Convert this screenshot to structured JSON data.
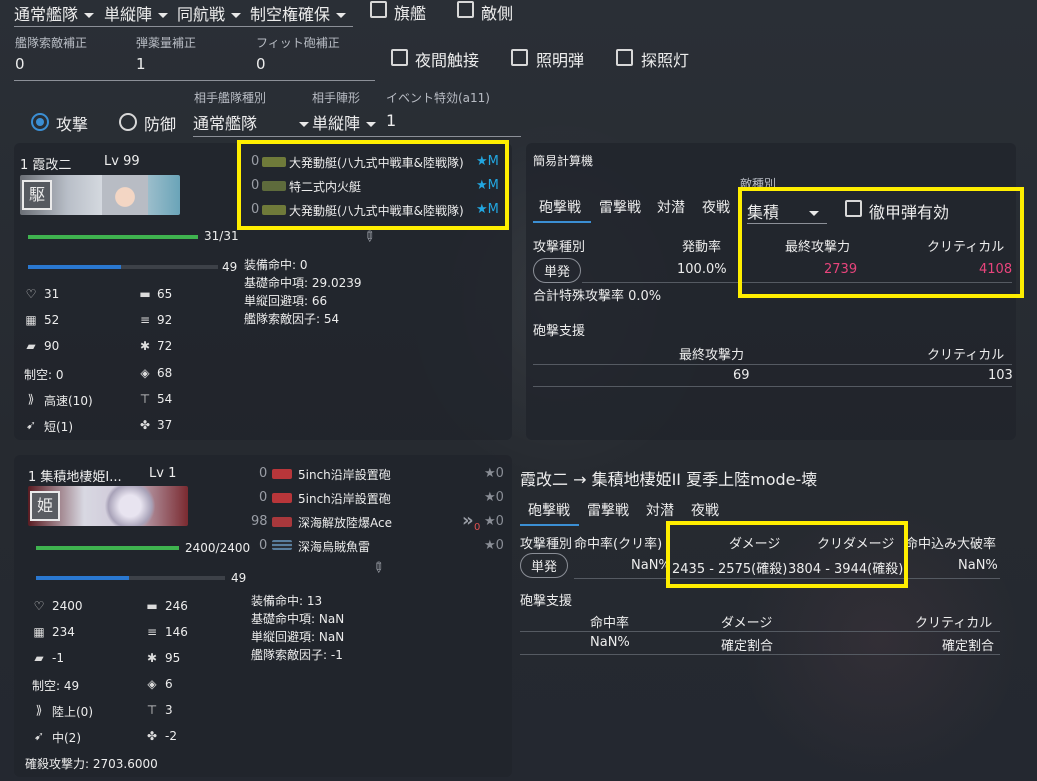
{
  "top": {
    "fleet_type": "通常艦隊",
    "formation": "単縦陣",
    "battle": "同航戦",
    "air_state": "制空権確保",
    "flagship": "旗艦",
    "enemy_side": "敵側"
  },
  "corrections": {
    "scout_label": "艦隊索敵補正",
    "scout_value": "0",
    "ammo_label": "弾薬量補正",
    "ammo_value": "1",
    "fit_label": "フィット砲補正",
    "fit_value": "0"
  },
  "night_opts": {
    "contact": "夜間触接",
    "flare": "照明弾",
    "searchlight": "探照灯"
  },
  "mode": {
    "attack": "攻撃",
    "defense": "防御"
  },
  "enemy_settings": {
    "fleet_label": "相手艦隊種別",
    "fleet_value": "通常艦隊",
    "form_label": "相手陣形",
    "form_value": "単縦陣",
    "event_label": "イベント特効(a11)",
    "event_value": "1"
  },
  "ship1": {
    "name": "1 霞改二",
    "level": "Lv 99",
    "hp": "31/31",
    "fuel": "49",
    "hp_frac": 1.0,
    "fuel_frac": 0.49,
    "stats": {
      "hp": "31",
      "firepower": "65",
      "armor": "52",
      "torpedo": "92",
      "evasion": "90",
      "aa": "72",
      "air": "制空: 0",
      "asw": "68",
      "speed": "高速(10)",
      "los": "54",
      "range": "短(1)",
      "luck": "37"
    },
    "equipment": [
      {
        "lv": "0",
        "name": "大発動艇(八九式中戦車&陸戦隊)",
        "prof": "★M"
      },
      {
        "lv": "0",
        "name": "特二式内火艇",
        "prof": "★M"
      },
      {
        "lv": "0",
        "name": "大発動艇(八九式中戦車&陸戦隊)",
        "prof": "★M"
      }
    ],
    "extra": [
      "装備命中: 0",
      "基礎命中項: 29.0239",
      "単縦回避項: 66",
      "艦隊索敵因子: 54"
    ]
  },
  "ship2": {
    "name": "1 集積地棲姫I...",
    "level": "Lv 1",
    "hp": "2400/2400",
    "fuel": "49",
    "hp_frac": 1.0,
    "fuel_frac": 0.49,
    "stats": {
      "hp": "2400",
      "firepower": "246",
      "armor": "234",
      "torpedo": "146",
      "evasion": "-1",
      "aa": "95",
      "air": "制空: 49",
      "asw": "6",
      "speed": "陸上(0)",
      "los": "3",
      "range": "中(2)",
      "luck": "-2"
    },
    "equipment": [
      {
        "lv": "0",
        "name": "5inch沿岸設置砲",
        "prof": "★0"
      },
      {
        "lv": "0",
        "name": "5inch沿岸設置砲",
        "prof": "★0"
      },
      {
        "lv": "98",
        "name": "深海解放陸爆Ace",
        "prof": "★0",
        "slot": "0"
      },
      {
        "lv": "0",
        "name": "深海烏賊魚雷",
        "prof": "★0"
      }
    ],
    "extra": [
      "装備命中: 13",
      "基礎命中項: NaN",
      "単縦回避項: NaN",
      "艦隊索敵因子: -1"
    ],
    "kill_power": "確殺攻撃力: 2703.6000"
  },
  "calc": {
    "title": "簡易計算機",
    "tabs": [
      "砲撃戦",
      "雷撃戦",
      "対潜",
      "夜戦"
    ],
    "enemy_type_label": "敵種別",
    "enemy_type": "集積",
    "ap_label": "徹甲弾有効",
    "col_attack": "攻撃種別",
    "col_rate": "発動率",
    "col_final": "最終攻撃力",
    "col_crit": "クリティカル",
    "row_type": "単発",
    "row_rate": "100.0%",
    "row_final": "2739",
    "row_crit": "4108",
    "total_special": "合計特殊攻撃率 0.0%",
    "support_title": "砲撃支援",
    "support_final": "69",
    "support_crit": "103"
  },
  "matchup": {
    "title": "霞改二 → 集積地棲姫II 夏季上陸mode-壊",
    "tabs": [
      "砲撃戦",
      "雷撃戦",
      "対潜",
      "夜戦"
    ],
    "col_type": "攻撃種別",
    "col_hit": "命中率(クリ率)",
    "col_dmg": "ダメージ",
    "col_cdmg": "クリダメージ",
    "col_inc": "命中込み大破率",
    "row_type": "単発",
    "row_hit": "NaN%",
    "row_dmg": "2435 - 2575(確殺)",
    "row_cdmg": "3804 - 3944(確殺)",
    "row_inc": "NaN%",
    "support_title": "砲撃支援",
    "s_col_hit": "命中率",
    "s_col_dmg": "ダメージ",
    "s_col_crit": "クリティカル",
    "s_hit": "NaN%",
    "s_dmg": "確定割合",
    "s_crit": "確定割合"
  }
}
